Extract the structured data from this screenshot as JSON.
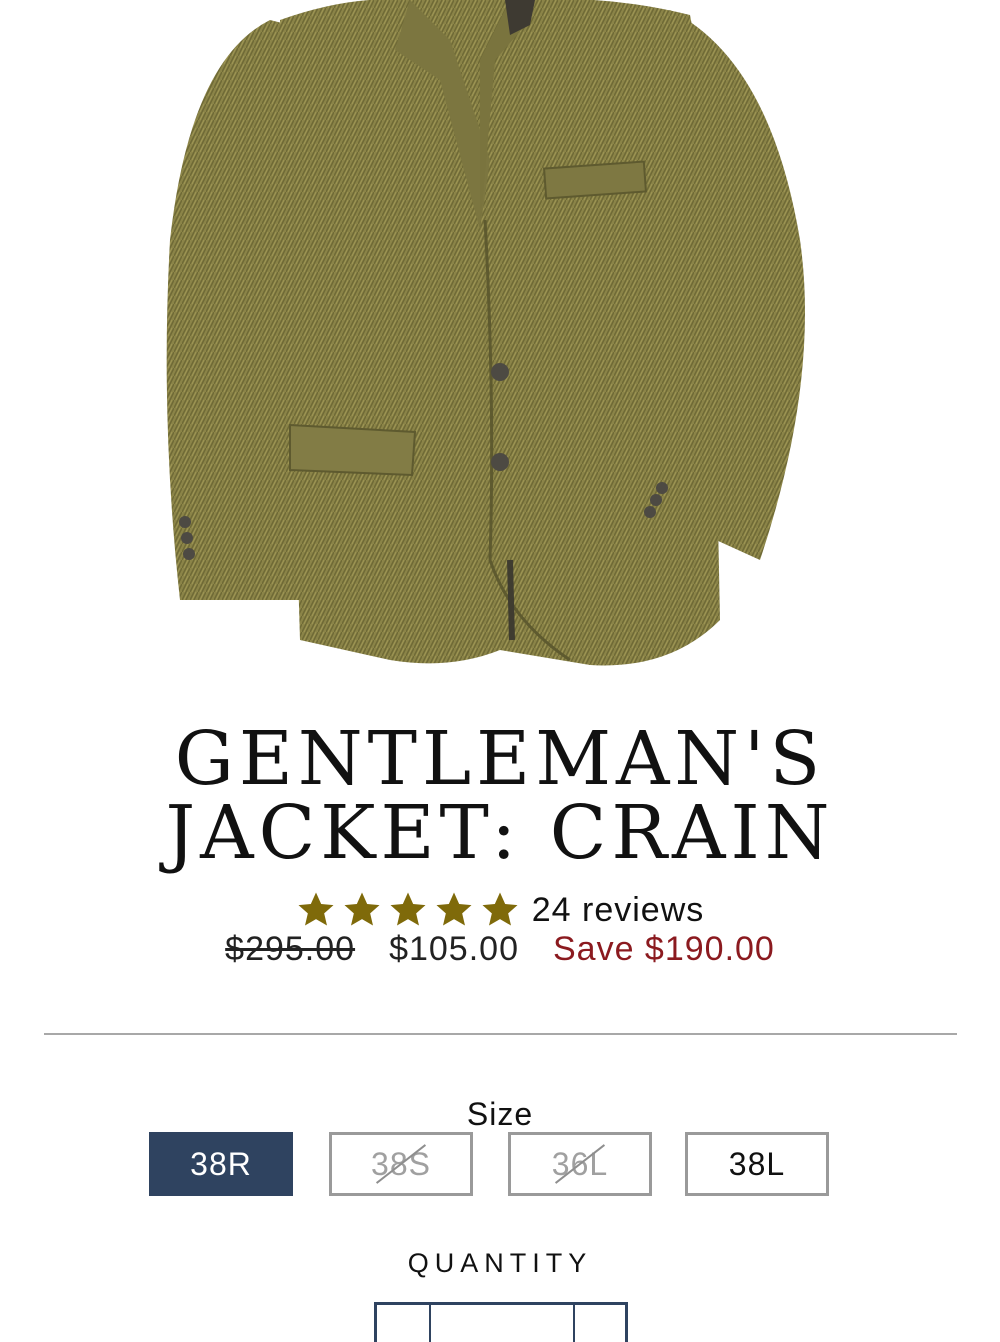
{
  "product": {
    "title_line1": "GENTLEMAN'S",
    "title_line2": "JACKET: CRAIN",
    "image_subject": "olive herringbone tweed jacket"
  },
  "rating": {
    "stars": 5,
    "max_stars": 5,
    "reviews_text": "24 reviews",
    "star_color": "#7f6a0a"
  },
  "pricing": {
    "compare_at": "$295.00",
    "price": "$105.00",
    "savings": "Save $190.00",
    "savings_color": "#8b1a1f"
  },
  "size": {
    "label": "Size",
    "options": [
      {
        "label": "38R",
        "selected": true,
        "available": true
      },
      {
        "label": "38S",
        "selected": false,
        "available": false
      },
      {
        "label": "36L",
        "selected": false,
        "available": false
      },
      {
        "label": "38L",
        "selected": false,
        "available": true
      }
    ],
    "selected_color": "#2f4360"
  },
  "quantity": {
    "label": "QUANTITY"
  }
}
